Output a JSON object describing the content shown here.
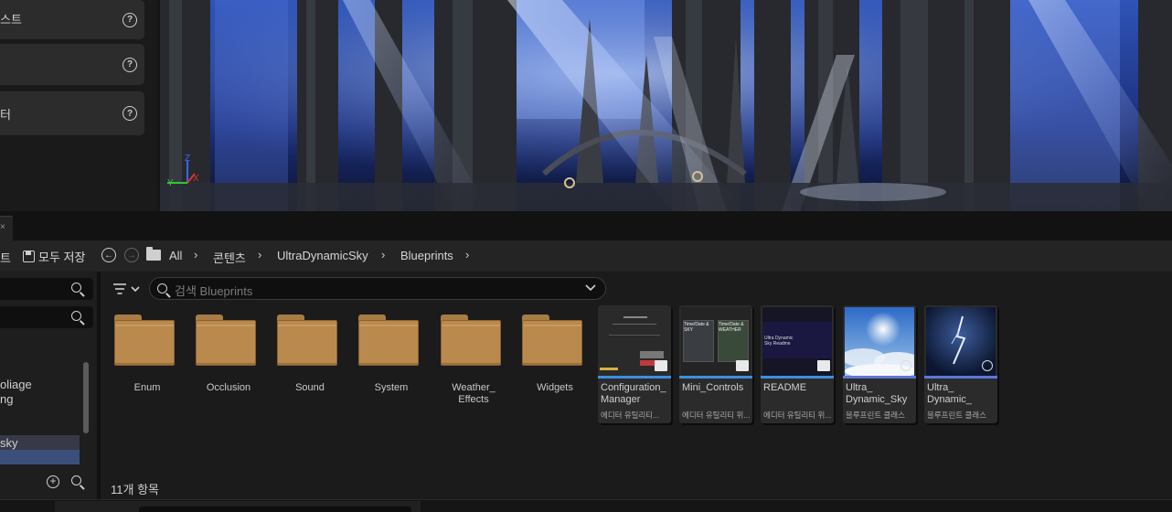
{
  "left_panel": {
    "rows": [
      {
        "label": "스트",
        "help": "?"
      },
      {
        "label": "",
        "help": "?"
      },
      {
        "label": "터",
        "help": "?"
      }
    ]
  },
  "viewport": {
    "axis_x": "X",
    "axis_y": "Y",
    "axis_z": "Z"
  },
  "toolbar": {
    "cut_text": "트",
    "save_all_label": "모두 저장",
    "breadcrumb": [
      "All",
      "콘텐츠",
      "UltraDynamicSky",
      "Blueprints"
    ]
  },
  "tree": {
    "items": [
      {
        "label": "oliage"
      },
      {
        "label": "ng"
      },
      {
        "label": "sky"
      }
    ]
  },
  "search": {
    "placeholder": "검색 Blueprints"
  },
  "folders": [
    {
      "name": "Enum"
    },
    {
      "name": "Occlusion"
    },
    {
      "name": "Sound"
    },
    {
      "name": "System"
    },
    {
      "name": "Weather_\nEffects"
    },
    {
      "name": "Widgets"
    }
  ],
  "assets": [
    {
      "name": "Configuration_\nManager",
      "type": "에디터 유틸리티...",
      "thumb_text": ""
    },
    {
      "name": "Mini_Controls",
      "type": "에디터 유틸리티 위...",
      "thumb_text_1": "Time/Date & SKY",
      "thumb_text_2": "Time/Date & WEATHER"
    },
    {
      "name": "README",
      "type": "에디터 유틸리티 위...",
      "thumb_text": "Ultra Dynamic Sky Readme"
    },
    {
      "name": "Ultra_\nDynamic_Sky",
      "type": "블루프린트 클래스"
    },
    {
      "name": "Ultra_\nDynamic_",
      "type": "블루프린트 클래스"
    }
  ],
  "status": {
    "item_count": "11개 항목"
  },
  "colors": {
    "folder": "#b9894e",
    "utility_line": "#3a8fe0",
    "blueprint_line": "#5d76d8",
    "tree_selection": "#3b4f7a"
  }
}
